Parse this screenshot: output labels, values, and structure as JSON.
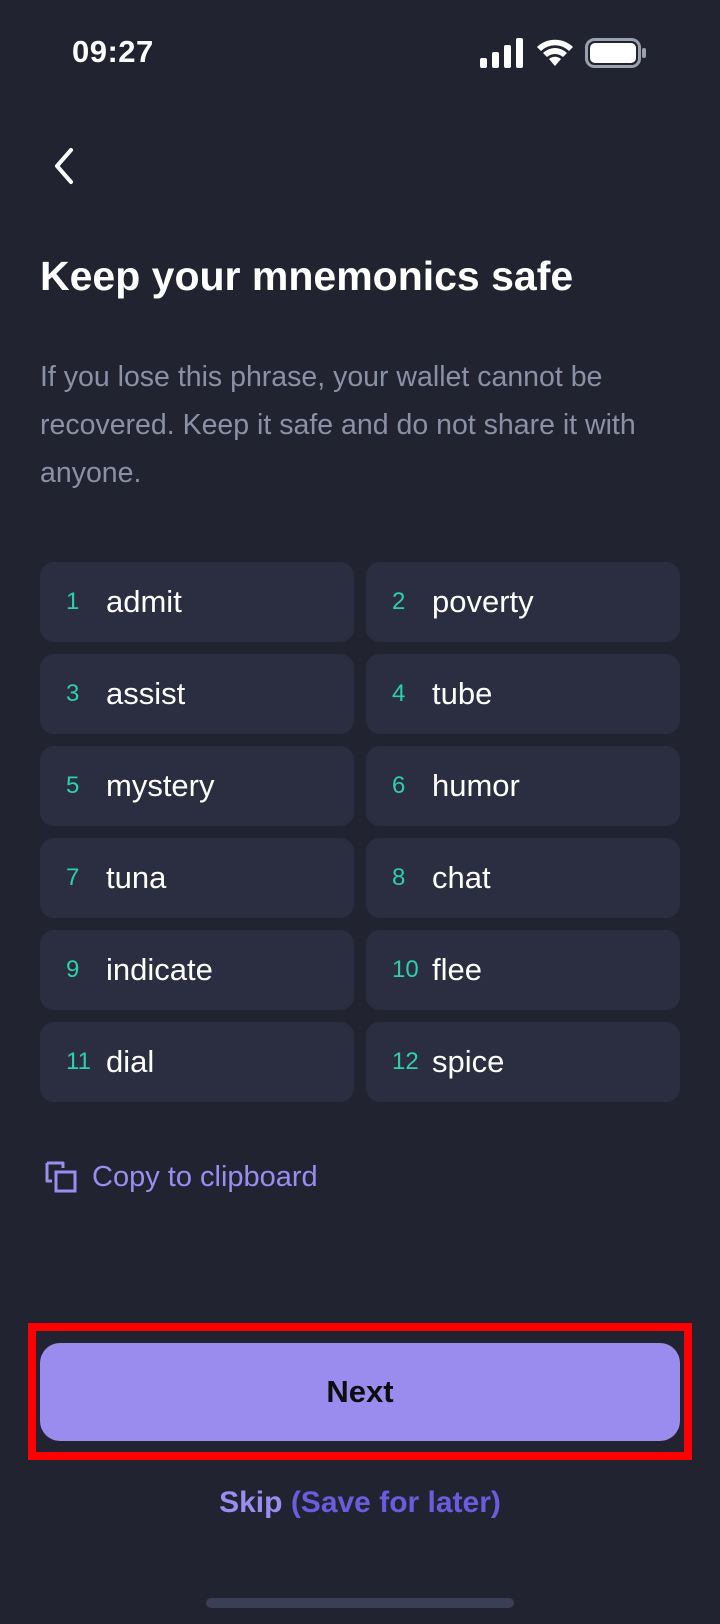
{
  "status_bar": {
    "time": "09:27",
    "icons": [
      "signal-icon",
      "wifi-icon",
      "battery-icon"
    ]
  },
  "nav": {
    "back_icon": "chevron-left-icon"
  },
  "title": "Keep your mnemonics safe",
  "description": "If you lose this phrase, your wallet cannot be recovered. Keep it safe and do not share it with anyone.",
  "words": [
    {
      "index": "1",
      "word": "admit"
    },
    {
      "index": "2",
      "word": "poverty"
    },
    {
      "index": "3",
      "word": "assist"
    },
    {
      "index": "4",
      "word": "tube"
    },
    {
      "index": "5",
      "word": "mystery"
    },
    {
      "index": "6",
      "word": "humor"
    },
    {
      "index": "7",
      "word": "tuna"
    },
    {
      "index": "8",
      "word": "chat"
    },
    {
      "index": "9",
      "word": "indicate"
    },
    {
      "index": "10",
      "word": "flee"
    },
    {
      "index": "11",
      "word": "dial"
    },
    {
      "index": "12",
      "word": "spice"
    }
  ],
  "copy": {
    "label": "Copy to clipboard",
    "icon": "copy-icon"
  },
  "next_button": {
    "label": "Next"
  },
  "skip": {
    "main": "Skip",
    "sub": "(Save for later)"
  },
  "colors": {
    "background": "#212430",
    "card": "#2a2e40",
    "accent": "#9a8cef",
    "index_green": "#2fcfa7",
    "highlight": "#ff0000"
  }
}
